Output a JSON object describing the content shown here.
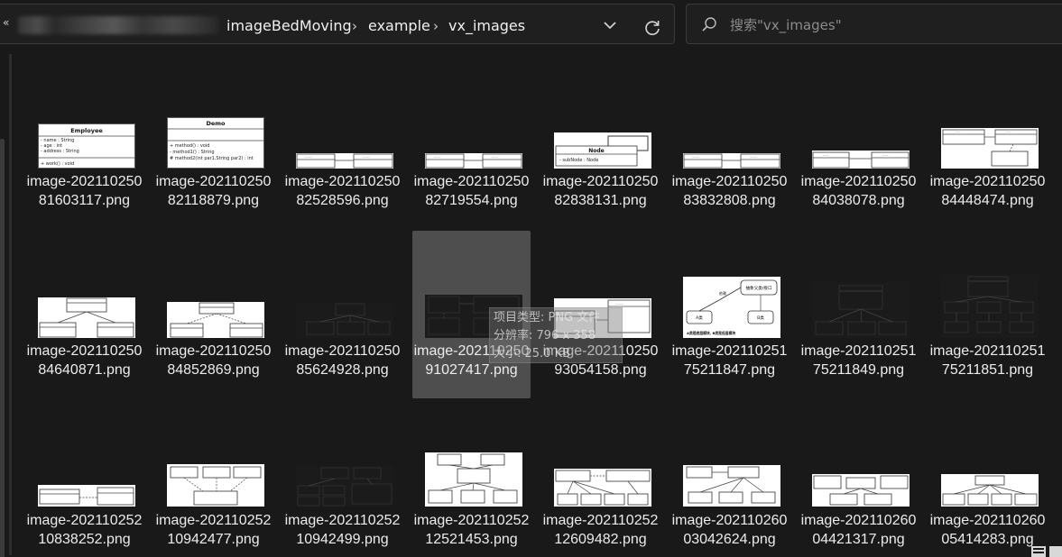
{
  "address_bar": {
    "crumbs": [
      "imageBedMoving",
      "example",
      "vx_images"
    ]
  },
  "search": {
    "placeholder": "搜索\"vx_images\""
  },
  "files": [
    {
      "name": "image-20211025081603117.png",
      "thumb": "employee"
    },
    {
      "name": "image-20211025082118879.png",
      "thumb": "demo"
    },
    {
      "name": "image-20211025082528596.png",
      "thumb": "twobox"
    },
    {
      "name": "image-20211025082719554.png",
      "thumb": "twobox"
    },
    {
      "name": "image-20211025082838131.png",
      "thumb": "node"
    },
    {
      "name": "image-20211025083832808.png",
      "thumb": "twobox"
    },
    {
      "name": "image-20211025084038078.png",
      "thumb": "twobox2"
    },
    {
      "name": "image-20211025084448474.png",
      "thumb": "threebox"
    },
    {
      "name": "image-20211025084640871.png",
      "thumb": "hier3"
    },
    {
      "name": "image-20211025084852869.png",
      "thumb": "hier2"
    },
    {
      "name": "image-20211025085624928.png",
      "thumb": "darkhier"
    },
    {
      "name": "image-20211025091027417.png",
      "thumb": "darkmix"
    },
    {
      "name": "image-20211025093054158.png",
      "thumb": "twobox3"
    },
    {
      "name": "image-20211025175211847.png",
      "thumb": "abflow"
    },
    {
      "name": "image-20211025175211849.png",
      "thumb": "darkhier2"
    },
    {
      "name": "image-20211025175211851.png",
      "thumb": "darkhier3"
    },
    {
      "name": "image-20211025210838252.png",
      "thumb": "wide2"
    },
    {
      "name": "image-20211025210942477.png",
      "thumb": "tri"
    },
    {
      "name": "image-20211025210942499.png",
      "thumb": "darkbig"
    },
    {
      "name": "image-20211025212521453.png",
      "thumb": "tree"
    },
    {
      "name": "image-20211025212609482.png",
      "thumb": "tree2"
    },
    {
      "name": "image-20211026003042624.png",
      "thumb": "tree3"
    },
    {
      "name": "image-20211026004421317.png",
      "thumb": "tree4"
    },
    {
      "name": "image-20211026005414283.png",
      "thumb": "tree5"
    }
  ],
  "selected_index": 11,
  "tooltip": {
    "type": "项目类型: PNG 文件",
    "resolution": "分辨率: 796 x 358",
    "size": "大小: 25.0 KB"
  },
  "thumbnails": {
    "employee": {
      "title": "Employee",
      "fields": [
        "- name : String",
        "- age : int",
        "- address : String"
      ],
      "method": "+ work() : void"
    },
    "demo": {
      "title": "Demo",
      "methods": [
        "+ method() : void",
        "- method1() : String",
        "# method2(int par1,String par2) : int"
      ]
    },
    "node": {
      "title": "Node",
      "field": "- subNode : Node"
    },
    "abflow": {
      "top": "抽象父类/接口",
      "left": "A类",
      "right": "B类",
      "mid": "依赖",
      "note": "A类是底层模块, B类是低层模块"
    }
  },
  "colors": {
    "background": "#191919",
    "selected_tile": "#4e4e4e",
    "text": "#ececec"
  }
}
